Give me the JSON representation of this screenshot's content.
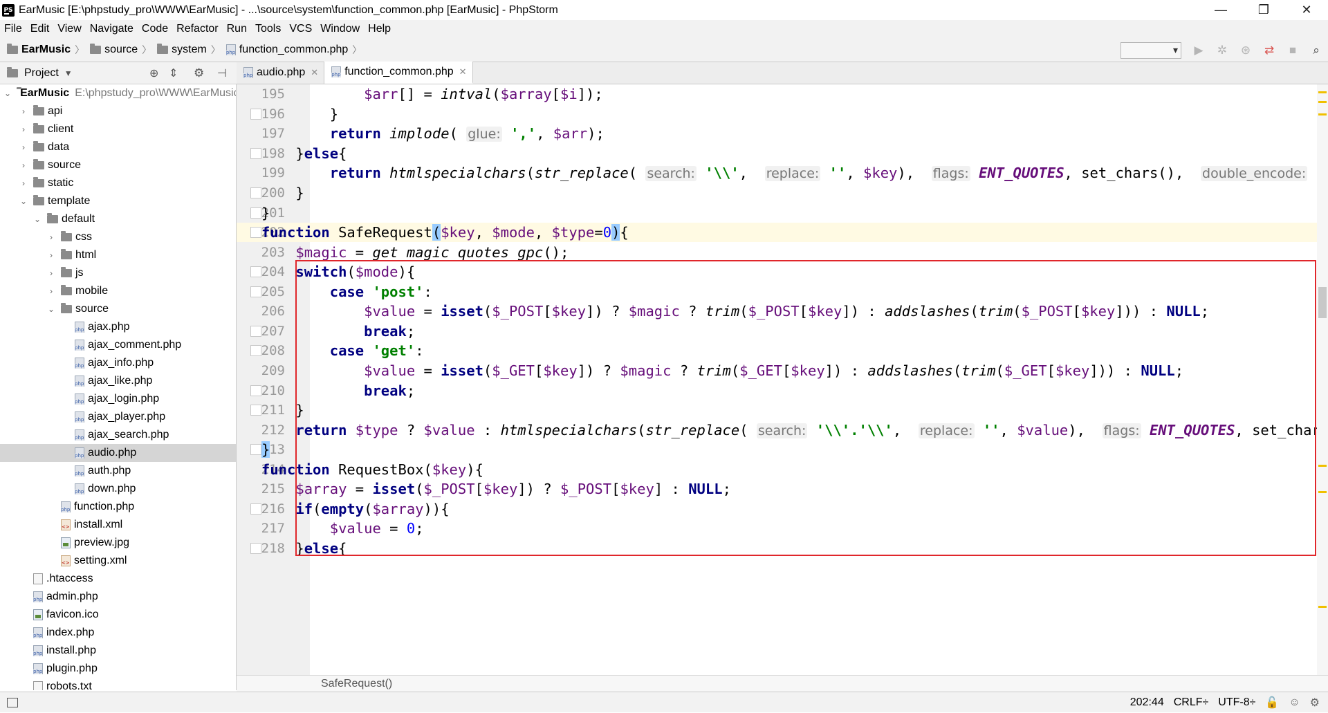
{
  "window": {
    "title": "EarMusic [E:\\phpstudy_pro\\WWW\\EarMusic] - ...\\source\\system\\function_common.php [EarMusic] - PhpStorm",
    "minimize": "—",
    "restore": "❐",
    "close": "✕"
  },
  "menu": [
    "File",
    "Edit",
    "View",
    "Navigate",
    "Code",
    "Refactor",
    "Run",
    "Tools",
    "VCS",
    "Window",
    "Help"
  ],
  "breadcrumb": [
    "EarMusic",
    "source",
    "system",
    "function_common.php"
  ],
  "project_panel": {
    "title": "Project",
    "root": {
      "label": "EarMusic",
      "path": "E:\\phpstudy_pro\\WWW\\EarMusic"
    },
    "items": [
      {
        "label": "api",
        "type": "folder",
        "depth": 1,
        "chevron": "›"
      },
      {
        "label": "client",
        "type": "folder",
        "depth": 1,
        "chevron": "›"
      },
      {
        "label": "data",
        "type": "folder",
        "depth": 1,
        "chevron": "›"
      },
      {
        "label": "source",
        "type": "folder",
        "depth": 1,
        "chevron": "›"
      },
      {
        "label": "static",
        "type": "folder",
        "depth": 1,
        "chevron": "›"
      },
      {
        "label": "template",
        "type": "folder",
        "depth": 1,
        "chevron": "⌄"
      },
      {
        "label": "default",
        "type": "folder",
        "depth": 2,
        "chevron": "⌄"
      },
      {
        "label": "css",
        "type": "folder",
        "depth": 3,
        "chevron": "›"
      },
      {
        "label": "html",
        "type": "folder",
        "depth": 3,
        "chevron": "›"
      },
      {
        "label": "js",
        "type": "folder",
        "depth": 3,
        "chevron": "›"
      },
      {
        "label": "mobile",
        "type": "folder",
        "depth": 3,
        "chevron": "›"
      },
      {
        "label": "source",
        "type": "folder",
        "depth": 3,
        "chevron": "⌄"
      },
      {
        "label": "ajax.php",
        "type": "php",
        "depth": 4
      },
      {
        "label": "ajax_comment.php",
        "type": "php",
        "depth": 4
      },
      {
        "label": "ajax_info.php",
        "type": "php",
        "depth": 4
      },
      {
        "label": "ajax_like.php",
        "type": "php",
        "depth": 4
      },
      {
        "label": "ajax_login.php",
        "type": "php",
        "depth": 4
      },
      {
        "label": "ajax_player.php",
        "type": "php",
        "depth": 4
      },
      {
        "label": "ajax_search.php",
        "type": "php",
        "depth": 4
      },
      {
        "label": "audio.php",
        "type": "php",
        "depth": 4,
        "selected": true
      },
      {
        "label": "auth.php",
        "type": "php",
        "depth": 4
      },
      {
        "label": "down.php",
        "type": "php",
        "depth": 4
      },
      {
        "label": "function.php",
        "type": "php",
        "depth": 3
      },
      {
        "label": "install.xml",
        "type": "xml",
        "depth": 3
      },
      {
        "label": "preview.jpg",
        "type": "img",
        "depth": 3
      },
      {
        "label": "setting.xml",
        "type": "xml",
        "depth": 3
      },
      {
        "label": ".htaccess",
        "type": "file",
        "depth": 1
      },
      {
        "label": "admin.php",
        "type": "php",
        "depth": 1
      },
      {
        "label": "favicon.ico",
        "type": "img",
        "depth": 1
      },
      {
        "label": "index.php",
        "type": "php",
        "depth": 1
      },
      {
        "label": "install.php",
        "type": "php",
        "depth": 1
      },
      {
        "label": "plugin.php",
        "type": "php",
        "depth": 1
      },
      {
        "label": "robots.txt",
        "type": "file",
        "depth": 1
      }
    ]
  },
  "tabs": [
    {
      "label": "audio.php",
      "active": false
    },
    {
      "label": "function_common.php",
      "active": true
    }
  ],
  "editor": {
    "lines": [
      {
        "n": "195",
        "html": "            <span class='var'>$arr</span>[] = <span class='fn-i'>intval</span>(<span class='var'>$array</span>[<span class='var'>$i</span>]);"
      },
      {
        "n": "196",
        "html": "        }"
      },
      {
        "n": "197",
        "html": "        <span class='kw'>return</span> <span class='fn-i'>implode</span>( <span class='hint'>glue:</span> <span class='str'>','</span>, <span class='var'>$arr</span>);"
      },
      {
        "n": "198",
        "html": "    }<span class='kw'>else</span>{"
      },
      {
        "n": "199",
        "html": "        <span class='kw'>return</span> <span class='fn-i'>htmlspecialchars</span>(<span class='fn-i'>str_replace</span>( <span class='hint'>search:</span> <span class='str'>'\\\\'</span>,  <span class='hint'>replace:</span> <span class='str'>''</span>, <span class='var'>$key</span>),  <span class='hint'>flags:</span> <span class='const'>ENT_QUOTES</span>, set_chars(),  <span class='hint'>double_encode:</span>"
      },
      {
        "n": "200",
        "html": "    }"
      },
      {
        "n": "201",
        "html": "}"
      },
      {
        "n": "202",
        "hl": true,
        "html": "<span class='kw'>function</span> SafeRequest<span class='match'>(</span><span class='var'>$key</span>, <span class='var'>$mode</span>, <span class='var'>$type</span>=<span class='num'>0</span><span class='match'>)</span>{"
      },
      {
        "n": "203",
        "html": "    <span class='var'>$magic</span> = <span class='fn-i'>get_magic_quotes_gpc</span>();"
      },
      {
        "n": "204",
        "html": "    <span class='kw'>switch</span>(<span class='var'>$mode</span>){"
      },
      {
        "n": "205",
        "html": "        <span class='kw'>case</span> <span class='str'>'post'</span>:"
      },
      {
        "n": "206",
        "html": "            <span class='var'>$value</span> = <span class='kw'>isset</span>(<span class='var'>$_POST</span>[<span class='var'>$key</span>]) ? <span class='var'>$magic</span> ? <span class='fn-i'>trim</span>(<span class='var'>$_POST</span>[<span class='var'>$key</span>]) : <span class='fn-i'>addslashes</span>(<span class='fn-i'>trim</span>(<span class='var'>$_POST</span>[<span class='var'>$key</span>])) : <span class='kw'>NULL</span>;"
      },
      {
        "n": "207",
        "html": "            <span class='kw'>break</span>;"
      },
      {
        "n": "208",
        "html": "        <span class='kw'>case</span> <span class='str'>'get'</span>:"
      },
      {
        "n": "209",
        "html": "            <span class='var'>$value</span> = <span class='kw'>isset</span>(<span class='var'>$_GET</span>[<span class='var'>$key</span>]) ? <span class='var'>$magic</span> ? <span class='fn-i'>trim</span>(<span class='var'>$_GET</span>[<span class='var'>$key</span>]) : <span class='fn-i'>addslashes</span>(<span class='fn-i'>trim</span>(<span class='var'>$_GET</span>[<span class='var'>$key</span>])) : <span class='kw'>NULL</span>;"
      },
      {
        "n": "210",
        "html": "            <span class='kw'>break</span>;"
      },
      {
        "n": "211",
        "html": "    }"
      },
      {
        "n": "212",
        "html": "    <span class='kw'>return</span> <span class='var'>$type</span> ? <span class='var'>$value</span> : <span class='fn-i'>htmlspecialchars</span>(<span class='fn-i'>str_replace</span>( <span class='hint'>search:</span> <span class='str'>'\\\\'.'\\\\'</span>,  <span class='hint'>replace:</span> <span class='str'>''</span>, <span class='var'>$value</span>),  <span class='hint'>flags:</span> <span class='const'>ENT_QUOTES</span>, set_chars()"
      },
      {
        "n": "213",
        "html": "<span class='match'>}</span>"
      },
      {
        "n": "214",
        "html": "<span class='kw'>function</span> RequestBox(<span class='var'>$key</span>){"
      },
      {
        "n": "215",
        "html": "    <span class='var'>$array</span> = <span class='kw'>isset</span>(<span class='var'>$_POST</span>[<span class='var'>$key</span>]) ? <span class='var'>$_POST</span>[<span class='var'>$key</span>] : <span class='kw'>NULL</span>;"
      },
      {
        "n": "216",
        "html": "    <span class='kw'>if</span>(<span class='kw'>empty</span>(<span class='var'>$array</span>)){"
      },
      {
        "n": "217",
        "html": "        <span class='var'>$value</span> = <span class='num'>0</span>;"
      },
      {
        "n": "218",
        "html": "    }<span class='kw'>else</span>{"
      }
    ],
    "code_breadcrumb": "SafeRequest()"
  },
  "status": {
    "position": "202:44",
    "line_sep": "CRLF÷",
    "encoding": "UTF-8÷"
  },
  "colors": {
    "keyword": "#000080",
    "variable": "#660e7a",
    "string": "#008000",
    "number": "#0000ff",
    "highlight_box": "#e0262b",
    "current_line": "#fffae3"
  }
}
